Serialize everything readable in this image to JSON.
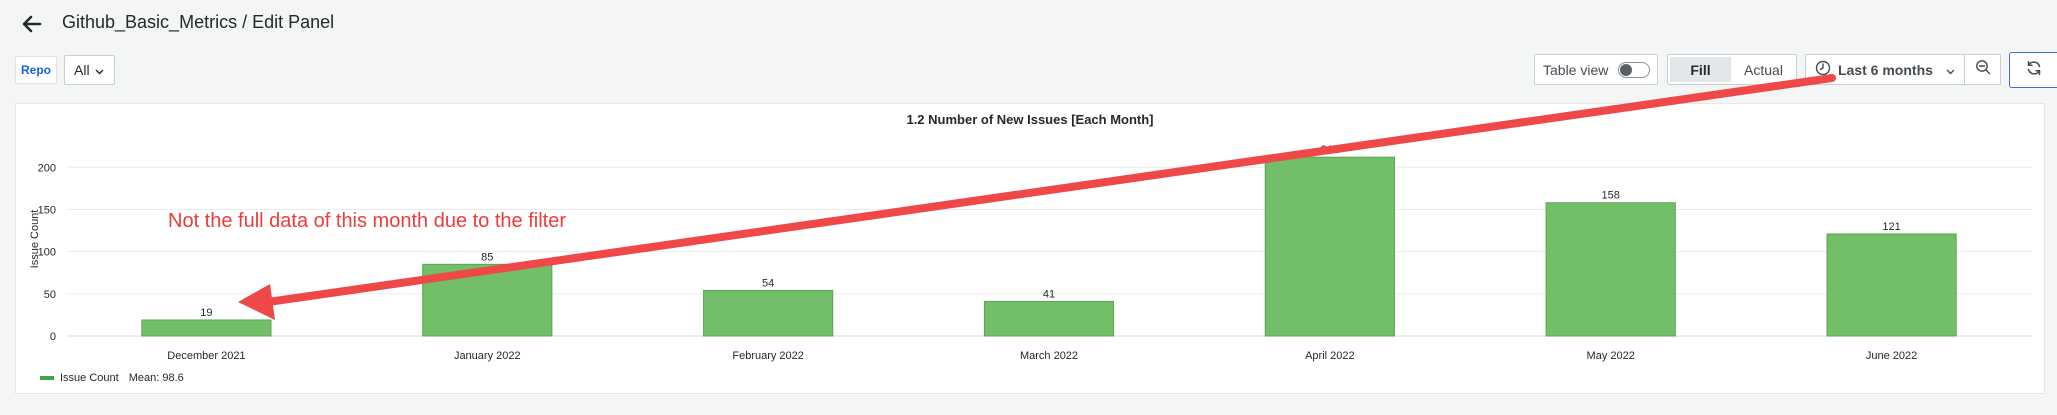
{
  "header": {
    "title": "Github_Basic_Metrics / Edit Panel"
  },
  "variables": {
    "repo_label": "Repo",
    "repo_value": "All"
  },
  "toolbar": {
    "table_view_label": "Table view",
    "fill_label": "Fill",
    "actual_label": "Actual",
    "time_range": "Last 6 months"
  },
  "panel": {
    "title": "1.2 Number of New Issues [Each Month]"
  },
  "chart_data": {
    "type": "bar",
    "title": "1.2 Number of New Issues [Each Month]",
    "ylabel": "Issue Count",
    "xlabel": "",
    "categories": [
      "December 2021",
      "January 2022",
      "February 2022",
      "March 2022",
      "April 2022",
      "May 2022",
      "June 2022"
    ],
    "series": [
      {
        "name": "Issue Count",
        "values": [
          19,
          85,
          54,
          41,
          212,
          158,
          121
        ]
      }
    ],
    "y_ticks": [
      0,
      50,
      100,
      150,
      200
    ],
    "ylim": [
      0,
      230
    ],
    "grid": true,
    "bar_color": "#73bf69",
    "legend": {
      "label": "Issue Count",
      "mean_text": "Mean: 98.6",
      "placement": "bottom-left"
    }
  },
  "annotation": {
    "text": "Not the full data of this month due to the filter",
    "color": "#ef3b3b"
  }
}
